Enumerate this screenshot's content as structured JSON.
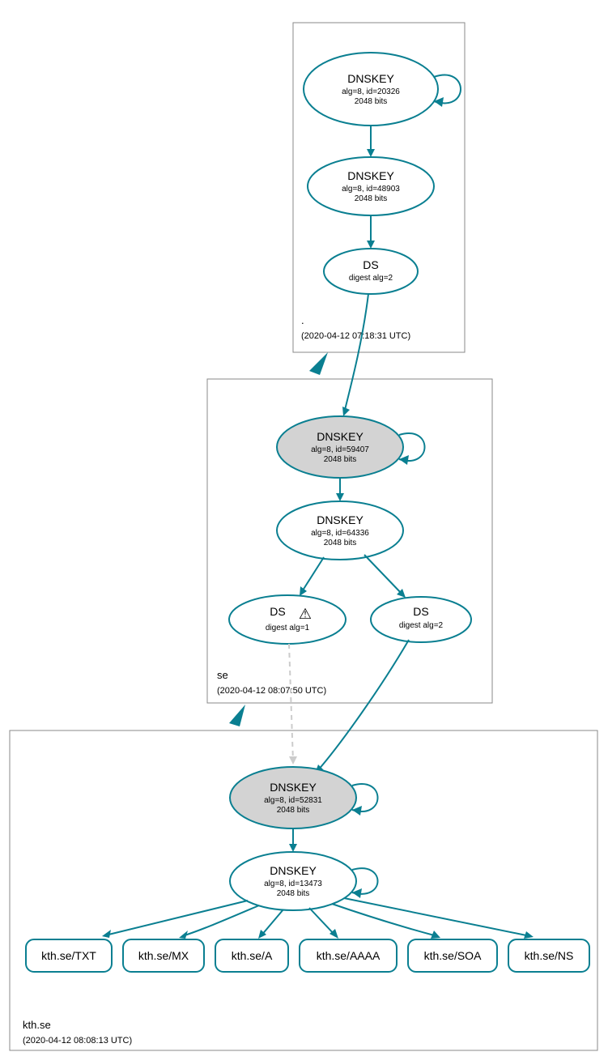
{
  "zones": {
    "root": {
      "name": ".",
      "timestamp": "(2020-04-12 07:18:31 UTC)"
    },
    "se": {
      "name": "se",
      "timestamp": "(2020-04-12 08:07:50 UTC)"
    },
    "kth": {
      "name": "kth.se",
      "timestamp": "(2020-04-12 08:08:13 UTC)"
    }
  },
  "nodes": {
    "root_ksk": {
      "t": "DNSKEY",
      "s": "alg=8, id=20326",
      "b": "2048 bits"
    },
    "root_zsk": {
      "t": "DNSKEY",
      "s": "alg=8, id=48903",
      "b": "2048 bits"
    },
    "root_ds": {
      "t": "DS",
      "s": "digest alg=2"
    },
    "se_ksk": {
      "t": "DNSKEY",
      "s": "alg=8, id=59407",
      "b": "2048 bits"
    },
    "se_zsk": {
      "t": "DNSKEY",
      "s": "alg=8, id=64336",
      "b": "2048 bits"
    },
    "se_ds1": {
      "t": "DS",
      "s": "digest alg=1",
      "warn": "⚠"
    },
    "se_ds2": {
      "t": "DS",
      "s": "digest alg=2"
    },
    "kth_ksk": {
      "t": "DNSKEY",
      "s": "alg=8, id=52831",
      "b": "2048 bits"
    },
    "kth_zsk": {
      "t": "DNSKEY",
      "s": "alg=8, id=13473",
      "b": "2048 bits"
    }
  },
  "leaves": {
    "txt": "kth.se/TXT",
    "mx": "kth.se/MX",
    "a": "kth.se/A",
    "aaaa": "kth.se/AAAA",
    "soa": "kth.se/SOA",
    "ns": "kth.se/NS"
  },
  "colors": {
    "stroke": "#0a7f91",
    "ksk_fill": "#d3d3d3"
  }
}
